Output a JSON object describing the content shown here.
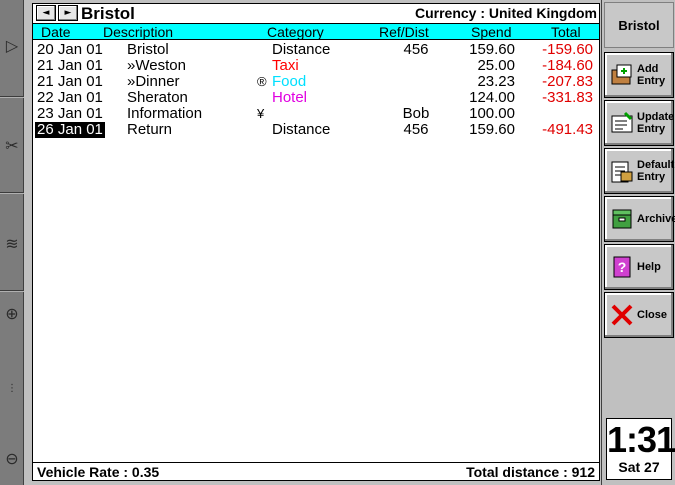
{
  "file": {
    "title": "Bristol",
    "currency_label": "Currency : United Kingdom"
  },
  "nav": {
    "prev": "◄",
    "next": "►"
  },
  "columns": [
    "Date",
    "Description",
    "Category",
    "Ref/Dist",
    "Spend",
    "Total"
  ],
  "rows": [
    {
      "date": "20 Jan 01",
      "desc": "Bristol",
      "mark": "",
      "cat": "Distance",
      "cat_color": "#000000",
      "ref": "456",
      "spend": "159.60",
      "total": "-159.60"
    },
    {
      "date": "21 Jan 01",
      "desc": "»Weston",
      "mark": "",
      "cat": "Taxi",
      "cat_color": "#ff0000",
      "ref": "",
      "spend": "25.00",
      "total": "-184.60"
    },
    {
      "date": "21 Jan 01",
      "desc": "»Dinner",
      "mark": "®",
      "cat": "Food",
      "cat_color": "#00e0ff",
      "ref": "",
      "spend": "23.23",
      "total": "-207.83"
    },
    {
      "date": "22 Jan 01",
      "desc": "Sheraton",
      "mark": "",
      "cat": "Hotel",
      "cat_color": "#e000e0",
      "ref": "",
      "spend": "124.00",
      "total": "-331.83"
    },
    {
      "date": "23 Jan 01",
      "desc": "Information",
      "mark": "¥",
      "cat": "",
      "cat_color": "#000000",
      "ref": "Bob",
      "spend": "100.00",
      "total": ""
    },
    {
      "date": "26 Jan 01",
      "desc": "Return",
      "mark": "",
      "cat": "Distance",
      "cat_color": "#000000",
      "ref": "456",
      "spend": "159.60",
      "total": "-491.43",
      "selected": true
    }
  ],
  "footer": {
    "vehicle_rate": "Vehicle Rate : 0.35",
    "total_distance": "Total distance : 912"
  },
  "toolbar": {
    "title": "Bristol",
    "buttons": [
      {
        "name": "add-entry",
        "label": "Add\nEntry",
        "icon": "add-entry-icon"
      },
      {
        "name": "update-entry",
        "label": "Update\nEntry",
        "icon": "update-entry-icon"
      },
      {
        "name": "default-entry",
        "label": "Default\nEntry",
        "icon": "default-entry-icon"
      },
      {
        "name": "archive",
        "label": "Archive",
        "icon": "archive-icon"
      },
      {
        "name": "help",
        "label": "Help",
        "icon": "help-icon"
      },
      {
        "name": "close",
        "label": "Close",
        "icon": "close-icon"
      }
    ]
  },
  "clock": {
    "time": "1:31",
    "date": "Sat 27"
  },
  "colors": {
    "header_bg": "#00ffff",
    "total_red": "#e00000"
  }
}
